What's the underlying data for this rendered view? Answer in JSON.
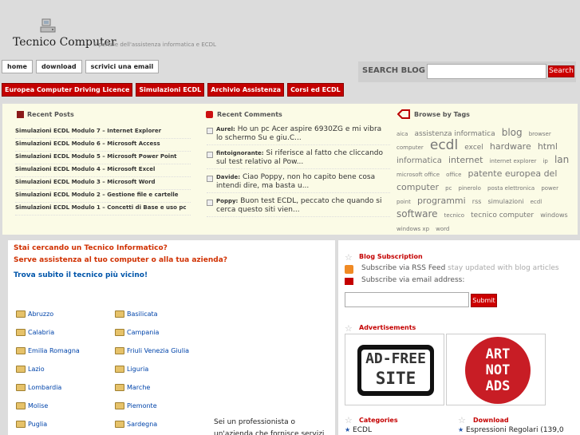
{
  "header": {
    "title": "Tecnico Computer",
    "tagline": "Il portale dell'assistenza informatica e ECDL"
  },
  "topnav": [
    "home",
    "download",
    "scrivici una email"
  ],
  "search": {
    "label": "SEARCH BLOG",
    "button": "Search"
  },
  "rednav": [
    "Europea Computer Driving Licence",
    "Simulazioni ECDL",
    "Archivio Assistenza",
    "Corsi ed ECDL"
  ],
  "recent_posts": {
    "title": "Recent Posts",
    "items": [
      "Simulazioni ECDL Modulo 7 – Internet Explorer",
      "Simulazioni ECDL Modulo 6 – Microsoft Access",
      "Simulazioni ECDL Modulo 5 – Microsoft Power Point",
      "Simulazioni ECDL Modulo 4 – Microsoft Excel",
      "Simulazioni ECDL Modulo 3 – Microsoft Word",
      "Simulazioni ECDL Modulo 2 – Gestione file e cartelle",
      "Simulazioni ECDL Modulo 1 – Concetti di Base e uso pc"
    ]
  },
  "recent_comments": {
    "title": "Recent Comments",
    "items": [
      {
        "author": "Aurel:",
        "text": "Ho un pc Acer aspire 6930ZG e mi vibra lo schermo Su e giu.C..."
      },
      {
        "author": "fintoignorante:",
        "text": "Si riferisce al fatto che cliccando sul test relativo al Pow..."
      },
      {
        "author": "Davide:",
        "text": "Ciao Poppy, non ho capito bene cosa intendi dire, ma basta u..."
      },
      {
        "author": "Poppy:",
        "text": "Buon test ECDL, peccato che quando si cerca questo siti vien..."
      }
    ]
  },
  "tags": {
    "title": "Browse by Tags",
    "items": [
      {
        "t": "aica",
        "s": 7
      },
      {
        "t": "assistenza informatica",
        "s": 9
      },
      {
        "t": "blog",
        "s": 12
      },
      {
        "t": "browser",
        "s": 7
      },
      {
        "t": "computer",
        "s": 7
      },
      {
        "t": "ecdl",
        "s": 17
      },
      {
        "t": "excel",
        "s": 9
      },
      {
        "t": "hardware",
        "s": 11
      },
      {
        "t": "html",
        "s": 11
      },
      {
        "t": "informatica",
        "s": 10
      },
      {
        "t": "internet",
        "s": 11
      },
      {
        "t": "internet explorer",
        "s": 7
      },
      {
        "t": "ip",
        "s": 7
      },
      {
        "t": "lan",
        "s": 12
      },
      {
        "t": "microsoft office",
        "s": 7
      },
      {
        "t": "office",
        "s": 7
      },
      {
        "t": "patente europea del computer",
        "s": 11
      },
      {
        "t": "pc",
        "s": 7
      },
      {
        "t": "pinerolo",
        "s": 7
      },
      {
        "t": "posta elettronica",
        "s": 7
      },
      {
        "t": "power point",
        "s": 7
      },
      {
        "t": "programmi",
        "s": 11
      },
      {
        "t": "rss",
        "s": 8
      },
      {
        "t": "simulazioni",
        "s": 8
      },
      {
        "t": "ecdl",
        "s": 7
      },
      {
        "t": "software",
        "s": 12
      },
      {
        "t": "tecnico",
        "s": 7
      },
      {
        "t": "tecnico computer",
        "s": 9
      },
      {
        "t": "windows",
        "s": 8
      },
      {
        "t": "windows xp",
        "s": 7
      },
      {
        "t": "word",
        "s": 7
      }
    ]
  },
  "main": {
    "q1": "Stai cercando un Tecnico Informatico?",
    "q2": "Serve assistenza al tuo computer o alla tua azienda?",
    "q3": "Trova subito il tecnico più vicino!",
    "regions": [
      "Abruzzo",
      "Basilicata",
      "Calabria",
      "Campania",
      "Emilia Romagna",
      "Friuli Venezia Giulia",
      "Lazio",
      "Liguria",
      "Lombardia",
      "Marche",
      "Molise",
      "Piemonte",
      "Puglia",
      "Sardegna"
    ],
    "pro_text": "Sei un professionista o un'azienda che fornisce servizi"
  },
  "sidebar": {
    "subscription_title": "Blog Subscription",
    "rss_link": "Subscribe via RSS Feed",
    "rss_note": "stay updated with blog articles",
    "email_label": "Subscribe via email address:",
    "submit": "Submit",
    "ads_title": "Advertisements",
    "ad1_line1": "AD-FREE",
    "ad1_line2": "SITE",
    "ad2_lines": [
      "ART",
      "NOT",
      "ADS"
    ],
    "categories_title": "Categories",
    "category_item": "ECDL",
    "download_title": "Download",
    "download_item": "Espressioni Regolari (139,0"
  }
}
